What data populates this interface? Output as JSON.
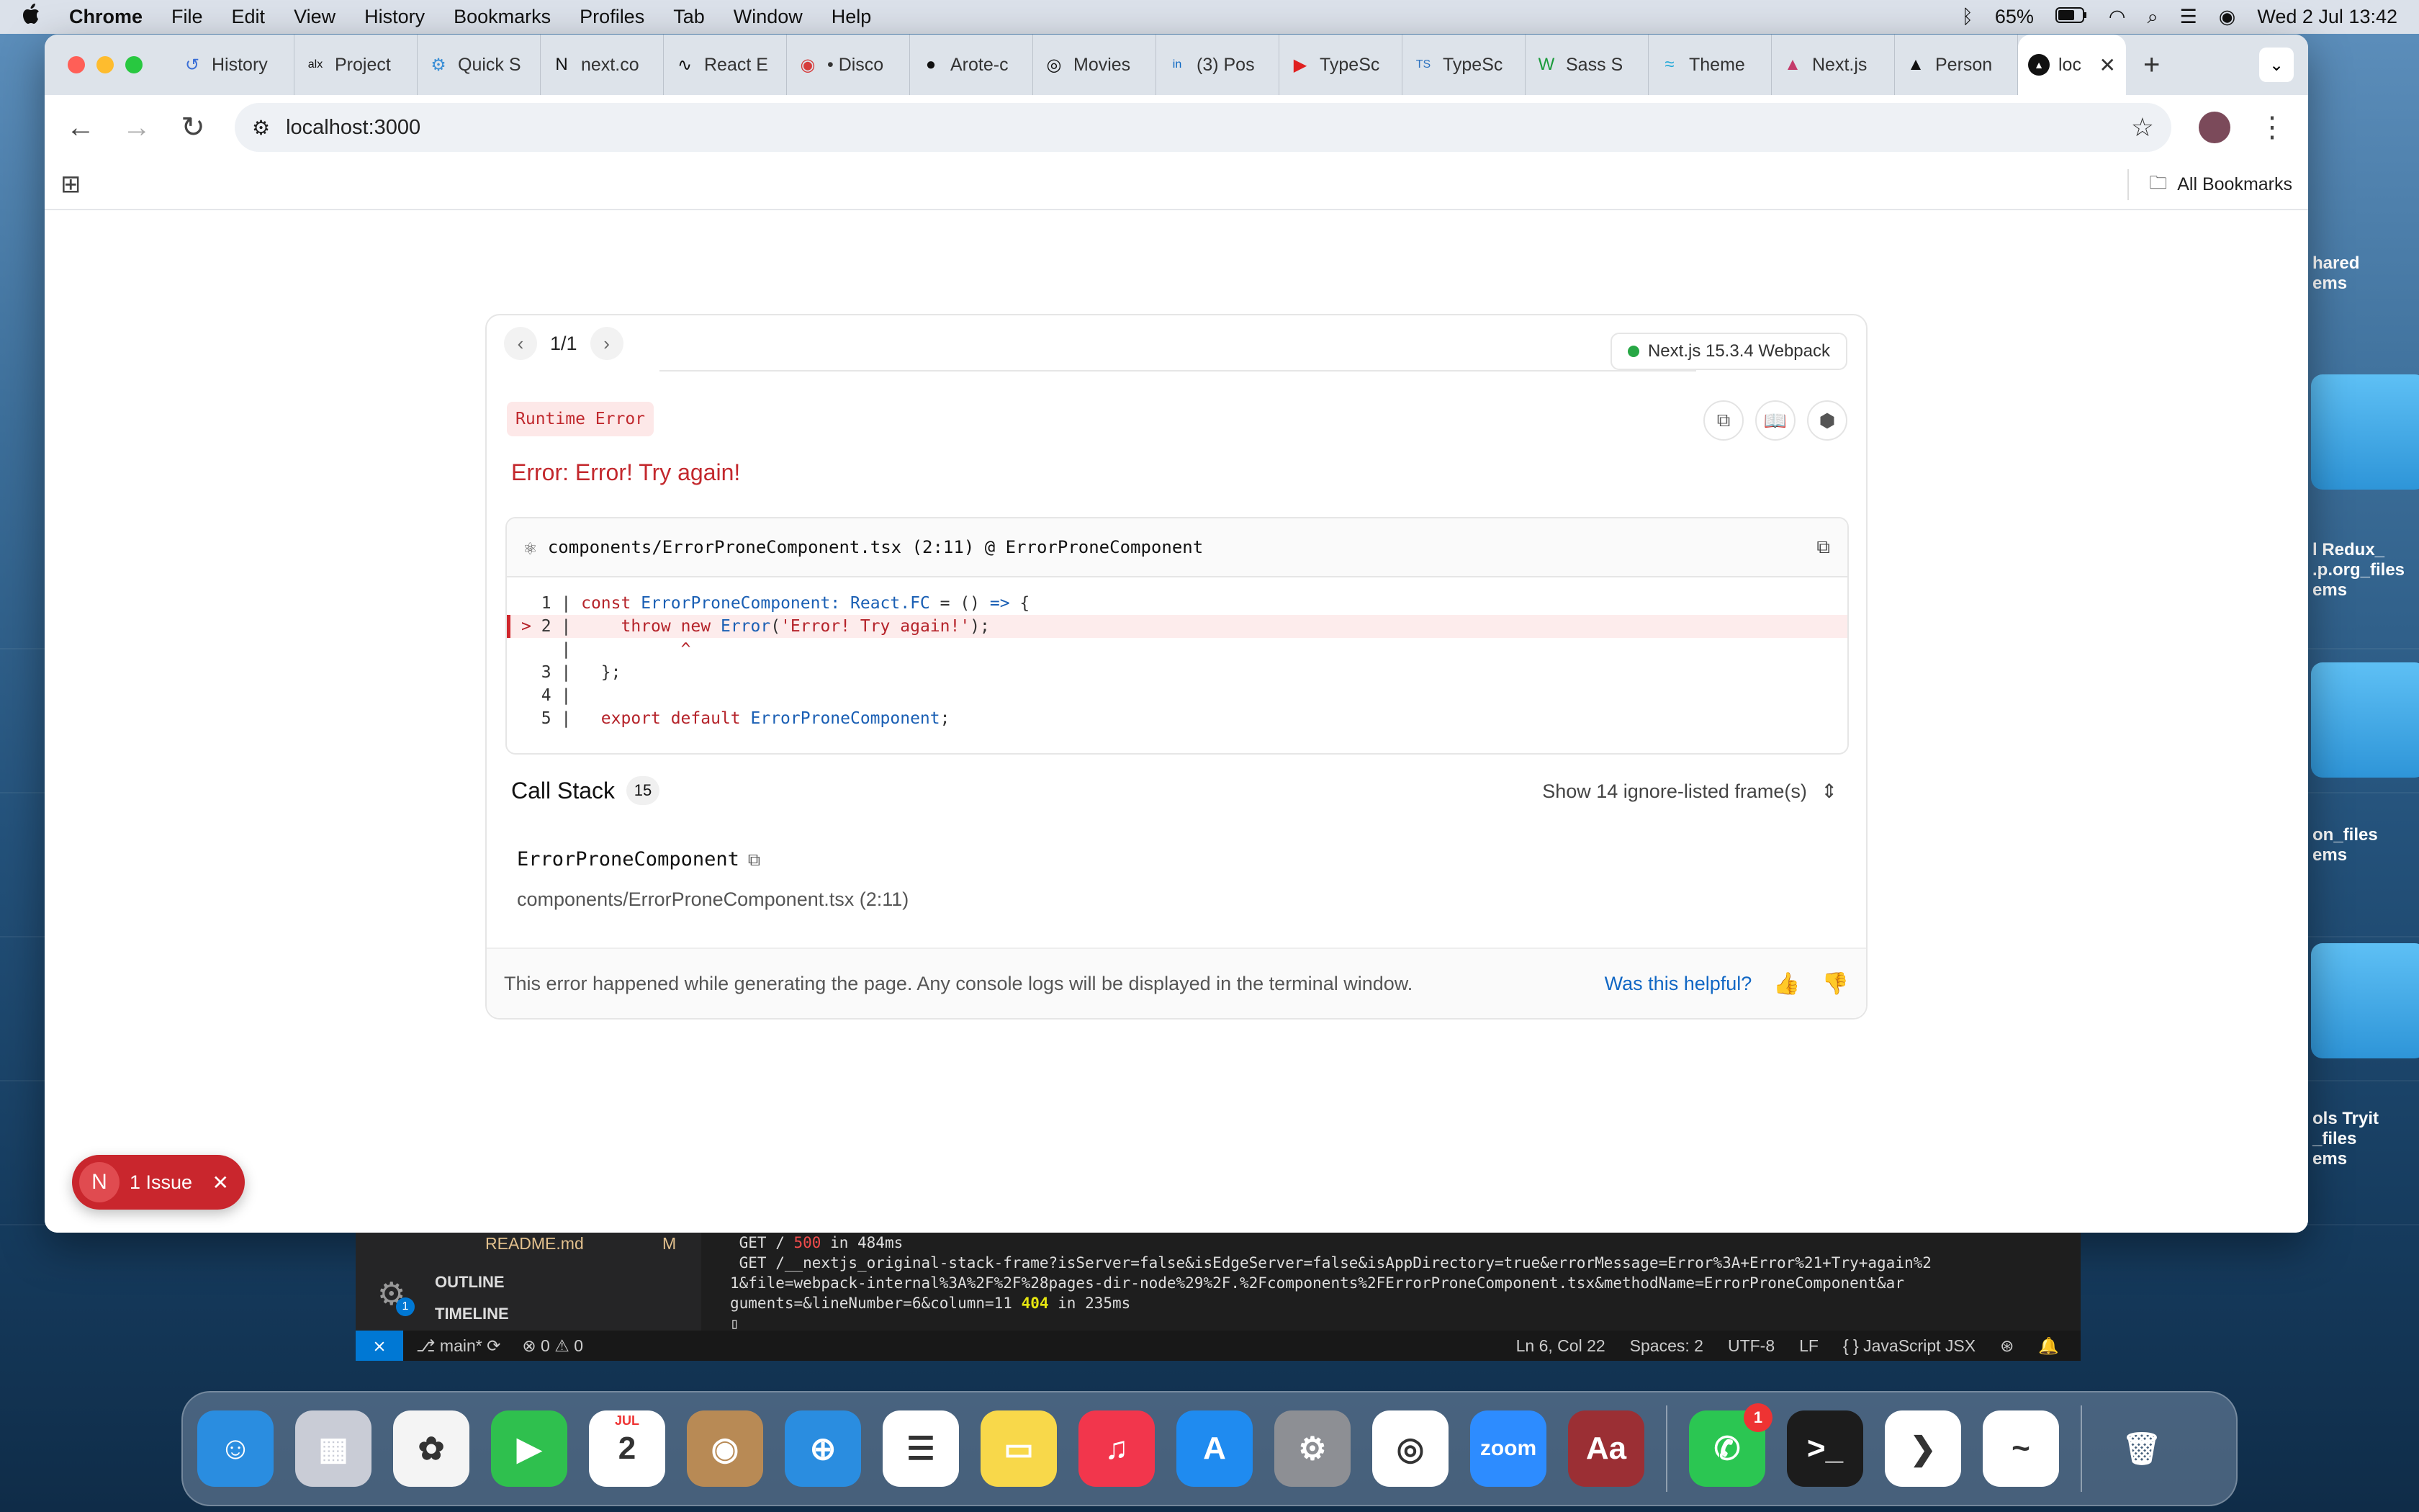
{
  "menubar": {
    "apple": "",
    "app": "Chrome",
    "items": [
      "File",
      "Edit",
      "View",
      "History",
      "Bookmarks",
      "Profiles",
      "Tab",
      "Window",
      "Help"
    ],
    "battery": "65%",
    "datetime": "Wed 2 Jul  13:42"
  },
  "tabs": [
    {
      "icon": "↺",
      "label": "History",
      "color": "#3b6fd6"
    },
    {
      "icon": "alx",
      "label": "Project",
      "color": "#111"
    },
    {
      "icon": "⚙",
      "label": "Quick S",
      "color": "#3b8fd6"
    },
    {
      "icon": "N",
      "label": "next.co",
      "color": "#111"
    },
    {
      "icon": "∿",
      "label": "React E",
      "color": "#111"
    },
    {
      "icon": "◉",
      "label": "• Disco",
      "color": "#d63b3b"
    },
    {
      "icon": "●",
      "label": "Arote-c",
      "color": "#111"
    },
    {
      "icon": "◎",
      "label": "Movies",
      "color": "#111"
    },
    {
      "icon": "in",
      "label": "(3) Pos",
      "color": "#0a66c2"
    },
    {
      "icon": "▶",
      "label": "TypeSc",
      "color": "#e02020"
    },
    {
      "icon": "TS",
      "label": "TypeSc",
      "color": "#2f74c0"
    },
    {
      "icon": "W",
      "label": "Sass S",
      "color": "#1a9a3a"
    },
    {
      "icon": "≈",
      "label": "Theme",
      "color": "#22a8d8"
    },
    {
      "icon": "▲",
      "label": "Next.js",
      "color": "#c43a6a"
    },
    {
      "icon": "▲",
      "label": "Person",
      "color": "#111"
    }
  ],
  "active_tab": {
    "label": "loc"
  },
  "address": {
    "url": "localhost:3000"
  },
  "bookmarks": {
    "all_label": "All Bookmarks"
  },
  "overlay": {
    "pager": "1/1",
    "version": "Next.js 15.3.4 Webpack",
    "badge": "Runtime Error",
    "message": "Error: Error! Try again!",
    "file": "components/ErrorProneComponent.tsx (2:11) @ ErrorProneComponent",
    "call_stack_title": "Call Stack",
    "call_stack_count": "15",
    "ignore_toggle": "Show 14 ignore-listed frame(s)",
    "frame_name": "ErrorProneComponent",
    "frame_loc": "components/ErrorProneComponent.tsx (2:11)",
    "footer_text": "This error happened while generating the page. Any console logs will be displayed in the terminal window.",
    "helpful": "Was this helpful?"
  },
  "issue_badge": {
    "letter": "N",
    "label": "1 Issue"
  },
  "vscode": {
    "readme": "README.md",
    "readme_status": "M",
    "outline": "OUTLINE",
    "timeline": "TIMELINE",
    "settings_badge": "1",
    "branch": "main*",
    "problems": "⊗ 0 ⚠ 0",
    "position": "Ln 6, Col 22",
    "spaces": "Spaces: 2",
    "encoding": "UTF-8",
    "eol": "LF",
    "language": "{ } JavaScript JSX",
    "terminal": {
      "line1_pre": " GET / ",
      "line1_code": "500",
      "line1_post": " in 484ms",
      "line2": " GET /__nextjs_original-stack-frame?isServer=false&isEdgeServer=false&isAppDirectory=true&errorMessage=Error%3A+Error%21+Try+again%2",
      "line3_pre": "1&file=webpack-internal%3A%2F%2F%28pages-dir-node%29%2F.%2Fcomponents%2FErrorProneComponent.tsx&methodName=ErrorProneComponent&ar",
      "line4_pre": "guments=&lineNumber=6&column=11 ",
      "line4_code": "404",
      "line4_post": " in 235ms"
    }
  },
  "desktop_labels": [
    "hared\nems",
    "l Redux_\n.p.org_files\nems",
    "on_files\nems",
    "ols Tryit\n_files\nems"
  ],
  "dock": [
    {
      "name": "finder",
      "label": "☺",
      "bg": "#2a8de0"
    },
    {
      "name": "launchpad",
      "label": "▦",
      "bg": "#c9ccd6"
    },
    {
      "name": "photos",
      "label": "✿",
      "bg": "#f4f4f4"
    },
    {
      "name": "facetime",
      "label": "▶",
      "bg": "#2fc04e"
    },
    {
      "name": "calendar",
      "label": "2",
      "bg": "#ffffff"
    },
    {
      "name": "contacts",
      "label": "◉",
      "bg": "#b88a55"
    },
    {
      "name": "safari",
      "label": "⊕",
      "bg": "#2a8de0"
    },
    {
      "name": "reminders",
      "label": "☰",
      "bg": "#ffffff"
    },
    {
      "name": "notes",
      "label": "▭",
      "bg": "#f8d84a"
    },
    {
      "name": "music",
      "label": "♫",
      "bg": "#f2364c"
    },
    {
      "name": "appstore",
      "label": "A",
      "bg": "#1f8bf0"
    },
    {
      "name": "settings",
      "label": "⚙",
      "bg": "#8d8f94"
    },
    {
      "name": "chrome",
      "label": "◎",
      "bg": "#ffffff"
    },
    {
      "name": "zoom",
      "label": "zoom",
      "bg": "#2d8cff"
    },
    {
      "name": "dictionary",
      "label": "Aa",
      "bg": "#9b2f34"
    },
    {
      "name": "whatsapp",
      "label": "✆",
      "bg": "#2bc652"
    },
    {
      "name": "terminal",
      "label": ">_",
      "bg": "#1c1c1c"
    },
    {
      "name": "vscode",
      "label": "❯",
      "bg": "#ffffff"
    },
    {
      "name": "freeform",
      "label": "~",
      "bg": "#ffffff"
    },
    {
      "name": "trash",
      "label": "🗑",
      "bg": "transparent"
    }
  ],
  "calendar_month": "JUL",
  "whatsapp_badge": "1"
}
